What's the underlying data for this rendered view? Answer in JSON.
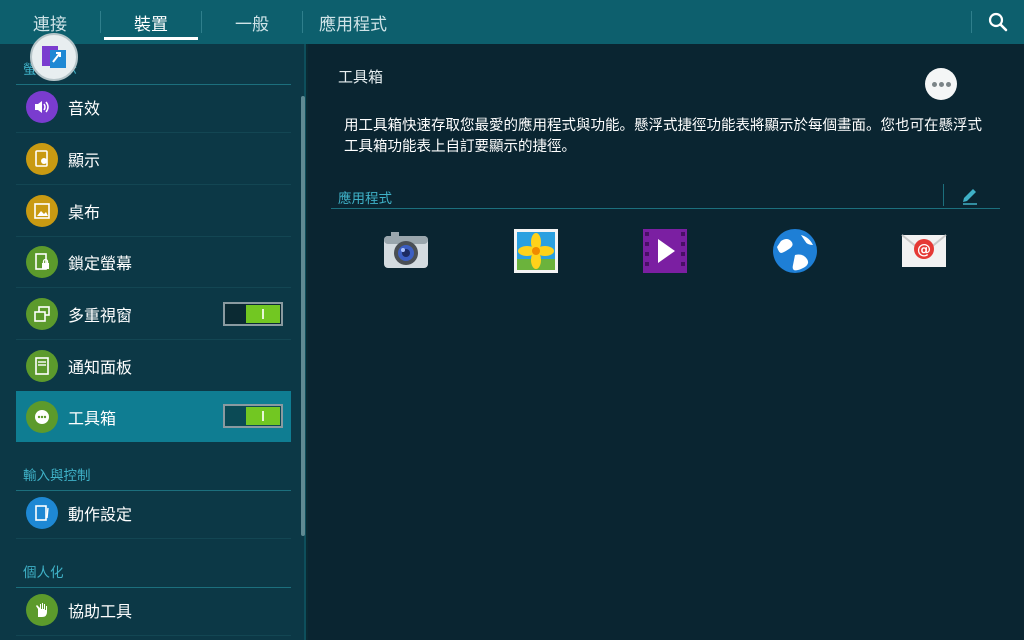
{
  "tabs": [
    {
      "label": "連接"
    },
    {
      "label": "裝置"
    },
    {
      "label": "一般"
    },
    {
      "label": "應用程式"
    }
  ],
  "sidebar": {
    "sections": [
      {
        "title": "螢幕顯示"
      },
      {
        "title": "輸入與控制"
      },
      {
        "title": "個人化"
      }
    ],
    "items": [
      {
        "label": "音效",
        "icon": "sound-icon",
        "color": "#7a3ccf"
      },
      {
        "label": "顯示",
        "icon": "display-icon",
        "color": "#c99a12"
      },
      {
        "label": "桌布",
        "icon": "wallpaper-icon",
        "color": "#c99a12"
      },
      {
        "label": "鎖定螢幕",
        "icon": "lock-screen-icon",
        "color": "#5c9a2c"
      },
      {
        "label": "多重視窗",
        "icon": "multi-window-icon",
        "color": "#5c9a2c",
        "toggle": "on"
      },
      {
        "label": "通知面板",
        "icon": "notification-panel-icon",
        "color": "#5c9a2c"
      },
      {
        "label": "工具箱",
        "icon": "toolbox-icon",
        "color": "#5c9a2c",
        "toggle": "on",
        "selected": true
      },
      {
        "label": "動作設定",
        "icon": "motion-icon",
        "color": "#1e88d4"
      },
      {
        "label": "協助工具",
        "icon": "accessibility-icon",
        "color": "#5c9a2c"
      }
    ]
  },
  "main": {
    "title": "工具箱",
    "description": "用工具箱快速存取您最愛的應用程式與功能。懸浮式捷徑功能表將顯示於每個畫面。您也可在懸浮式工具箱功能表上自訂要顯示的捷徑。",
    "apps_header": "應用程式",
    "apps": [
      {
        "icon": "camera-icon"
      },
      {
        "icon": "gallery-icon"
      },
      {
        "icon": "video-icon"
      },
      {
        "icon": "internet-icon"
      },
      {
        "icon": "email-icon"
      }
    ]
  },
  "colors": {
    "topbar": "#0d5f6d",
    "accent": "#3fb1c7",
    "selected": "#0f7d92",
    "toggle_on": "#72c722"
  }
}
